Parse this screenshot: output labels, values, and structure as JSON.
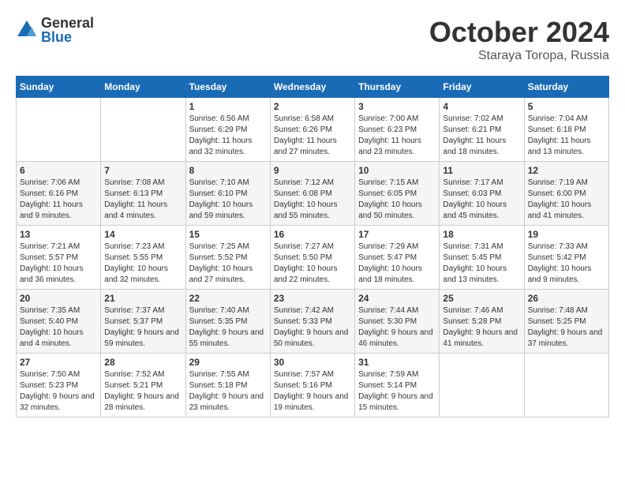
{
  "header": {
    "logo_general": "General",
    "logo_blue": "Blue",
    "month_title": "October 2024",
    "location": "Staraya Toropa, Russia"
  },
  "days_of_week": [
    "Sunday",
    "Monday",
    "Tuesday",
    "Wednesday",
    "Thursday",
    "Friday",
    "Saturday"
  ],
  "weeks": [
    [
      {
        "day": "",
        "sunrise": "",
        "sunset": "",
        "daylight": ""
      },
      {
        "day": "",
        "sunrise": "",
        "sunset": "",
        "daylight": ""
      },
      {
        "day": "1",
        "sunrise": "Sunrise: 6:56 AM",
        "sunset": "Sunset: 6:29 PM",
        "daylight": "Daylight: 11 hours and 32 minutes."
      },
      {
        "day": "2",
        "sunrise": "Sunrise: 6:58 AM",
        "sunset": "Sunset: 6:26 PM",
        "daylight": "Daylight: 11 hours and 27 minutes."
      },
      {
        "day": "3",
        "sunrise": "Sunrise: 7:00 AM",
        "sunset": "Sunset: 6:23 PM",
        "daylight": "Daylight: 11 hours and 23 minutes."
      },
      {
        "day": "4",
        "sunrise": "Sunrise: 7:02 AM",
        "sunset": "Sunset: 6:21 PM",
        "daylight": "Daylight: 11 hours and 18 minutes."
      },
      {
        "day": "5",
        "sunrise": "Sunrise: 7:04 AM",
        "sunset": "Sunset: 6:18 PM",
        "daylight": "Daylight: 11 hours and 13 minutes."
      }
    ],
    [
      {
        "day": "6",
        "sunrise": "Sunrise: 7:06 AM",
        "sunset": "Sunset: 6:16 PM",
        "daylight": "Daylight: 11 hours and 9 minutes."
      },
      {
        "day": "7",
        "sunrise": "Sunrise: 7:08 AM",
        "sunset": "Sunset: 6:13 PM",
        "daylight": "Daylight: 11 hours and 4 minutes."
      },
      {
        "day": "8",
        "sunrise": "Sunrise: 7:10 AM",
        "sunset": "Sunset: 6:10 PM",
        "daylight": "Daylight: 10 hours and 59 minutes."
      },
      {
        "day": "9",
        "sunrise": "Sunrise: 7:12 AM",
        "sunset": "Sunset: 6:08 PM",
        "daylight": "Daylight: 10 hours and 55 minutes."
      },
      {
        "day": "10",
        "sunrise": "Sunrise: 7:15 AM",
        "sunset": "Sunset: 6:05 PM",
        "daylight": "Daylight: 10 hours and 50 minutes."
      },
      {
        "day": "11",
        "sunrise": "Sunrise: 7:17 AM",
        "sunset": "Sunset: 6:03 PM",
        "daylight": "Daylight: 10 hours and 45 minutes."
      },
      {
        "day": "12",
        "sunrise": "Sunrise: 7:19 AM",
        "sunset": "Sunset: 6:00 PM",
        "daylight": "Daylight: 10 hours and 41 minutes."
      }
    ],
    [
      {
        "day": "13",
        "sunrise": "Sunrise: 7:21 AM",
        "sunset": "Sunset: 5:57 PM",
        "daylight": "Daylight: 10 hours and 36 minutes."
      },
      {
        "day": "14",
        "sunrise": "Sunrise: 7:23 AM",
        "sunset": "Sunset: 5:55 PM",
        "daylight": "Daylight: 10 hours and 32 minutes."
      },
      {
        "day": "15",
        "sunrise": "Sunrise: 7:25 AM",
        "sunset": "Sunset: 5:52 PM",
        "daylight": "Daylight: 10 hours and 27 minutes."
      },
      {
        "day": "16",
        "sunrise": "Sunrise: 7:27 AM",
        "sunset": "Sunset: 5:50 PM",
        "daylight": "Daylight: 10 hours and 22 minutes."
      },
      {
        "day": "17",
        "sunrise": "Sunrise: 7:29 AM",
        "sunset": "Sunset: 5:47 PM",
        "daylight": "Daylight: 10 hours and 18 minutes."
      },
      {
        "day": "18",
        "sunrise": "Sunrise: 7:31 AM",
        "sunset": "Sunset: 5:45 PM",
        "daylight": "Daylight: 10 hours and 13 minutes."
      },
      {
        "day": "19",
        "sunrise": "Sunrise: 7:33 AM",
        "sunset": "Sunset: 5:42 PM",
        "daylight": "Daylight: 10 hours and 9 minutes."
      }
    ],
    [
      {
        "day": "20",
        "sunrise": "Sunrise: 7:35 AM",
        "sunset": "Sunset: 5:40 PM",
        "daylight": "Daylight: 10 hours and 4 minutes."
      },
      {
        "day": "21",
        "sunrise": "Sunrise: 7:37 AM",
        "sunset": "Sunset: 5:37 PM",
        "daylight": "Daylight: 9 hours and 59 minutes."
      },
      {
        "day": "22",
        "sunrise": "Sunrise: 7:40 AM",
        "sunset": "Sunset: 5:35 PM",
        "daylight": "Daylight: 9 hours and 55 minutes."
      },
      {
        "day": "23",
        "sunrise": "Sunrise: 7:42 AM",
        "sunset": "Sunset: 5:33 PM",
        "daylight": "Daylight: 9 hours and 50 minutes."
      },
      {
        "day": "24",
        "sunrise": "Sunrise: 7:44 AM",
        "sunset": "Sunset: 5:30 PM",
        "daylight": "Daylight: 9 hours and 46 minutes."
      },
      {
        "day": "25",
        "sunrise": "Sunrise: 7:46 AM",
        "sunset": "Sunset: 5:28 PM",
        "daylight": "Daylight: 9 hours and 41 minutes."
      },
      {
        "day": "26",
        "sunrise": "Sunrise: 7:48 AM",
        "sunset": "Sunset: 5:25 PM",
        "daylight": "Daylight: 9 hours and 37 minutes."
      }
    ],
    [
      {
        "day": "27",
        "sunrise": "Sunrise: 7:50 AM",
        "sunset": "Sunset: 5:23 PM",
        "daylight": "Daylight: 9 hours and 32 minutes."
      },
      {
        "day": "28",
        "sunrise": "Sunrise: 7:52 AM",
        "sunset": "Sunset: 5:21 PM",
        "daylight": "Daylight: 9 hours and 28 minutes."
      },
      {
        "day": "29",
        "sunrise": "Sunrise: 7:55 AM",
        "sunset": "Sunset: 5:18 PM",
        "daylight": "Daylight: 9 hours and 23 minutes."
      },
      {
        "day": "30",
        "sunrise": "Sunrise: 7:57 AM",
        "sunset": "Sunset: 5:16 PM",
        "daylight": "Daylight: 9 hours and 19 minutes."
      },
      {
        "day": "31",
        "sunrise": "Sunrise: 7:59 AM",
        "sunset": "Sunset: 5:14 PM",
        "daylight": "Daylight: 9 hours and 15 minutes."
      },
      {
        "day": "",
        "sunrise": "",
        "sunset": "",
        "daylight": ""
      },
      {
        "day": "",
        "sunrise": "",
        "sunset": "",
        "daylight": ""
      }
    ]
  ]
}
